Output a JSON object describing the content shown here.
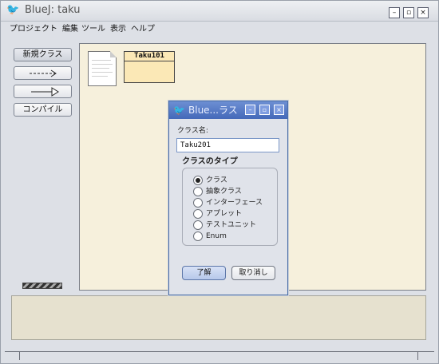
{
  "window": {
    "title": "BlueJ: taku",
    "icon": "bird-logo-icon",
    "controls": {
      "minimize": "–",
      "maximize": "▫",
      "close": "×"
    }
  },
  "menubar": {
    "items": [
      "プロジェクト",
      "編集",
      "ツール",
      "表示",
      "ヘルプ"
    ]
  },
  "toolbar": {
    "new_class": "新規クラス",
    "compile": "コンパイル"
  },
  "canvas": {
    "class_name": "Taku101"
  },
  "dialog": {
    "title": "Blue...ラス",
    "name_label": "クラス名:",
    "name_value": "Taku201",
    "type_label": "クラスのタイプ",
    "types": [
      {
        "label": "クラス",
        "selected": true
      },
      {
        "label": "抽象クラス",
        "selected": false
      },
      {
        "label": "インターフェース",
        "selected": false
      },
      {
        "label": "アプレット",
        "selected": false
      },
      {
        "label": "テストユニット",
        "selected": false
      },
      {
        "label": "Enum",
        "selected": false
      }
    ],
    "ok": "了解",
    "cancel": "取り消し",
    "controls": {
      "minimize": "–",
      "maximize": "▫",
      "close": "×"
    }
  },
  "colors": {
    "canvas_bg": "#f6f0dc",
    "class_fill": "#fbe8b6",
    "dialog_title": "#4469b9"
  }
}
